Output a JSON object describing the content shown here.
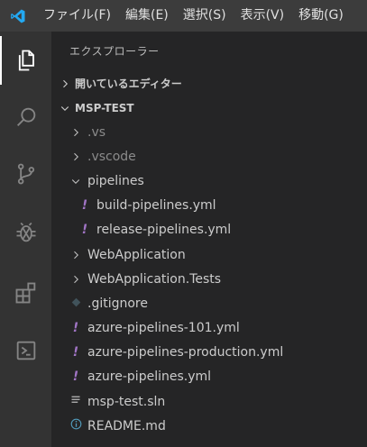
{
  "menu": [
    "ファイル(F)",
    "編集(E)",
    "選択(S)",
    "表示(V)",
    "移動(G)"
  ],
  "explorer": {
    "title": "エクスプローラー",
    "open_editors": "開いているエディター",
    "workspace": "MSP-TEST"
  },
  "tree": [
    {
      "label": ".vs",
      "type": "folder",
      "depth": 1,
      "dim": true
    },
    {
      "label": ".vscode",
      "type": "folder",
      "depth": 1,
      "dim": true
    },
    {
      "label": "pipelines",
      "type": "folder-open",
      "depth": 1
    },
    {
      "label": "build-pipelines.yml",
      "type": "yml",
      "depth": 2
    },
    {
      "label": "release-pipelines.yml",
      "type": "yml",
      "depth": 2
    },
    {
      "label": "WebApplication",
      "type": "folder",
      "depth": 1
    },
    {
      "label": "WebApplication.Tests",
      "type": "folder",
      "depth": 1
    },
    {
      "label": ".gitignore",
      "type": "git",
      "depth": 1
    },
    {
      "label": "azure-pipelines-101.yml",
      "type": "yml",
      "depth": 1
    },
    {
      "label": "azure-pipelines-production.yml",
      "type": "yml",
      "depth": 1
    },
    {
      "label": "azure-pipelines.yml",
      "type": "yml",
      "depth": 1
    },
    {
      "label": "msp-test.sln",
      "type": "sln",
      "depth": 1
    },
    {
      "label": "README.md",
      "type": "info",
      "depth": 1
    }
  ],
  "colors": {
    "accent": "#0078d4",
    "yml": "#a074c4",
    "info": "#519aba"
  }
}
